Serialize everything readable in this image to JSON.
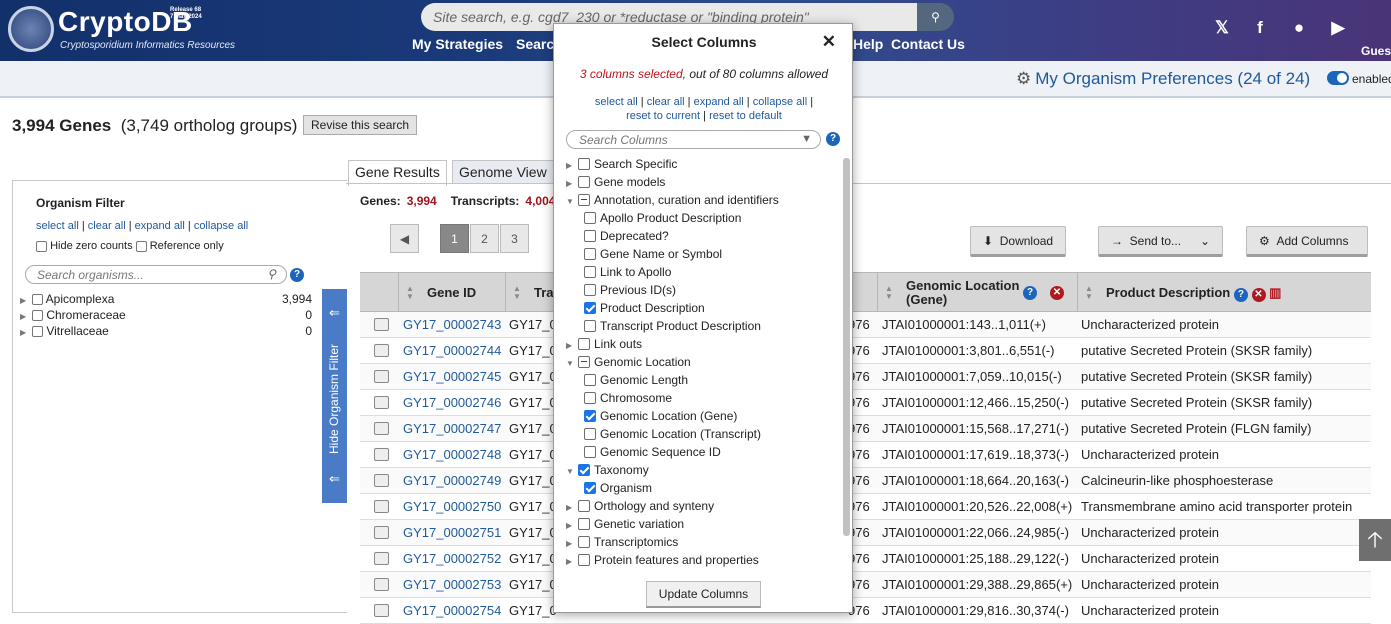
{
  "header": {
    "logo_text": "CryptoDB",
    "logo_sub": "Cryptosporidium Informatics Resources",
    "release": "Release 68",
    "release_date": "7 May 2024",
    "search_placeholder": "Site search, e.g. cgd7_230 or *reductase or \"binding protein\"",
    "nav": [
      "My Strategies",
      "Search",
      "Help",
      "Contact Us"
    ],
    "guest": "Guest",
    "social_icons": [
      "x-icon",
      "facebook-icon",
      "reddit-icon",
      "youtube-icon"
    ]
  },
  "prefs": {
    "label": "My Organism Preferences (24 of 24)",
    "toggle": "enabled"
  },
  "summary": {
    "genes": "3,994 Genes",
    "groups": "(3,749 ortholog groups)",
    "revise": "Revise this search"
  },
  "tabs": [
    "Gene Results",
    "Genome View"
  ],
  "sidebar": {
    "title": "Organism Filter",
    "links": [
      "select all",
      "clear all",
      "expand all",
      "collapse all"
    ],
    "hide_zero": "Hide zero counts",
    "reference_only": "Reference only",
    "search_placeholder": "Search organisms...",
    "organisms": [
      {
        "name": "Apicomplexa",
        "count": "3,994"
      },
      {
        "name": "Chromeraceae",
        "count": "0"
      },
      {
        "name": "Vitrellaceae",
        "count": "0"
      }
    ],
    "hide_filter": "Hide Organism Filter"
  },
  "results": {
    "genes_label": "Genes:",
    "genes_value": "3,994",
    "transcripts_label": "Transcripts:",
    "transcripts_value": "4,004",
    "pages": [
      "1",
      "2",
      "3"
    ],
    "download": "Download",
    "send_to": "Send to...",
    "add_columns": "Add Columns",
    "columns": [
      "Gene ID",
      "Tra",
      "Genomic Location (Gene)",
      "Product Description"
    ],
    "rows": [
      [
        "GY17_00002743",
        "GY17_0",
        "976",
        "JTAI01000001:143..1,011(+)",
        "Uncharacterized protein"
      ],
      [
        "GY17_00002744",
        "GY17_0",
        "976",
        "JTAI01000001:3,801..6,551(-)",
        "putative Secreted Protein (SKSR family)"
      ],
      [
        "GY17_00002745",
        "GY17_0",
        "976",
        "JTAI01000001:7,059..10,015(-)",
        "putative Secreted Protein (SKSR family)"
      ],
      [
        "GY17_00002746",
        "GY17_0",
        "976",
        "JTAI01000001:12,466..15,250(-)",
        "putative Secreted Protein (SKSR family)"
      ],
      [
        "GY17_00002747",
        "GY17_0",
        "976",
        "JTAI01000001:15,568..17,271(-)",
        "putative Secreted Protein (FLGN family)"
      ],
      [
        "GY17_00002748",
        "GY17_0",
        "976",
        "JTAI01000001:17,619..18,373(-)",
        "Uncharacterized protein"
      ],
      [
        "GY17_00002749",
        "GY17_0",
        "976",
        "JTAI01000001:18,664..20,163(-)",
        "Calcineurin-like phosphoesterase"
      ],
      [
        "GY17_00002750",
        "GY17_0",
        "976",
        "JTAI01000001:20,526..22,008(+)",
        "Transmembrane amino acid transporter protein"
      ],
      [
        "GY17_00002751",
        "GY17_0",
        "976",
        "JTAI01000001:22,066..24,985(-)",
        "Uncharacterized protein"
      ],
      [
        "GY17_00002752",
        "GY17_0",
        "976",
        "JTAI01000001:25,188..29,122(-)",
        "Uncharacterized protein"
      ],
      [
        "GY17_00002753",
        "GY17_0",
        "976",
        "JTAI01000001:29,388..29,865(+)",
        "Uncharacterized protein"
      ],
      [
        "GY17_00002754",
        "GY17_0",
        "976",
        "JTAI01000001:29,816..30,374(-)",
        "Uncharacterized protein"
      ]
    ]
  },
  "modal": {
    "title": "Select Columns",
    "selected": "3 columns selected",
    "allowed": ", out of 80 columns allowed",
    "links1": [
      "select all",
      "clear all",
      "expand all",
      "collapse all"
    ],
    "links2": [
      "reset to current",
      "reset to default"
    ],
    "search_placeholder": "Search Columns",
    "update": "Update Columns",
    "tree": [
      {
        "label": "Search Specific",
        "level": 0,
        "state": "none",
        "caret": "right"
      },
      {
        "label": "Gene models",
        "level": 0,
        "state": "none",
        "caret": "right"
      },
      {
        "label": "Annotation, curation and identifiers",
        "level": 0,
        "state": "part",
        "caret": "down"
      },
      {
        "label": "Apollo Product Description",
        "level": 1,
        "state": "none"
      },
      {
        "label": "Deprecated?",
        "level": 1,
        "state": "none"
      },
      {
        "label": "Gene Name or Symbol",
        "level": 1,
        "state": "none"
      },
      {
        "label": "Link to Apollo",
        "level": 1,
        "state": "none"
      },
      {
        "label": "Previous ID(s)",
        "level": 1,
        "state": "none"
      },
      {
        "label": "Product Description",
        "level": 1,
        "state": "chk"
      },
      {
        "label": "Transcript Product Description",
        "level": 1,
        "state": "none"
      },
      {
        "label": "Link outs",
        "level": 0,
        "state": "none",
        "caret": "right"
      },
      {
        "label": "Genomic Location",
        "level": 0,
        "state": "part",
        "caret": "down"
      },
      {
        "label": "Genomic Length",
        "level": 1,
        "state": "none"
      },
      {
        "label": "Chromosome",
        "level": 1,
        "state": "none"
      },
      {
        "label": "Genomic Location (Gene)",
        "level": 1,
        "state": "chk"
      },
      {
        "label": "Genomic Location (Transcript)",
        "level": 1,
        "state": "none"
      },
      {
        "label": "Genomic Sequence ID",
        "level": 1,
        "state": "none"
      },
      {
        "label": "Taxonomy",
        "level": 0,
        "state": "chk",
        "caret": "down"
      },
      {
        "label": "Organism",
        "level": 1,
        "state": "chk"
      },
      {
        "label": "Orthology and synteny",
        "level": 0,
        "state": "none",
        "caret": "right"
      },
      {
        "label": "Genetic variation",
        "level": 0,
        "state": "none",
        "caret": "right"
      },
      {
        "label": "Transcriptomics",
        "level": 0,
        "state": "none",
        "caret": "right"
      },
      {
        "label": "Protein features and properties",
        "level": 0,
        "state": "none",
        "caret": "right"
      }
    ]
  }
}
